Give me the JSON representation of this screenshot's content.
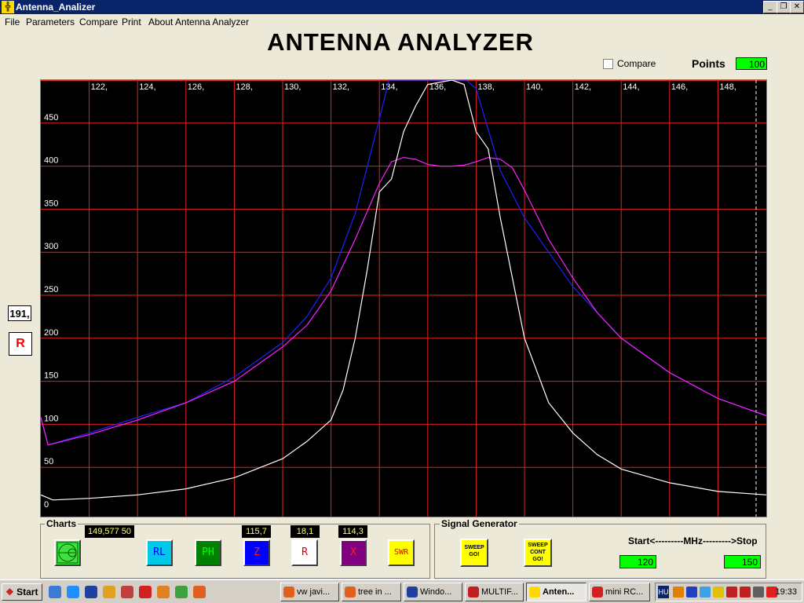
{
  "window": {
    "title": "Antenna_Analizer",
    "app_icon": "antenna-icon",
    "min_glyph": "_",
    "max_glyph": "❐",
    "close_glyph": "✕"
  },
  "menu": [
    "File",
    "Parameters",
    "Compare",
    "Print",
    "About Antenna Analyzer"
  ],
  "app_title": "ANTENNA ANALYZER",
  "compare_label": "Compare",
  "compare_checked": false,
  "points": {
    "label": "Points",
    "value": "100"
  },
  "side": {
    "value": "191,",
    "button_label": "R"
  },
  "charts_group": {
    "label": "Charts",
    "freq_readout": "149,577 50",
    "readouts": {
      "z": "115,7",
      "r": "18,1",
      "x": "114,3"
    },
    "buttons": [
      {
        "label": "",
        "icon": "smith-chart-icon",
        "color": "#40e040"
      },
      {
        "label": "RL",
        "color": "#00c8e8",
        "text_color": "#0000ff"
      },
      {
        "label": "PH",
        "color": "#008000",
        "text_color": "#00ff00"
      },
      {
        "label": "Z",
        "color": "#0000ff",
        "text_color": "#ff2020"
      },
      {
        "label": "R",
        "color": "#ffffff",
        "text_color": "#e00000"
      },
      {
        "label": "X",
        "color": "#800080",
        "text_color": "#ff2020"
      },
      {
        "label": "SWR",
        "color": "#ffff00",
        "text_color": "#e00000"
      }
    ]
  },
  "signal_group": {
    "label": "Signal Generator",
    "sweep": [
      "SWEEP",
      "GO!"
    ],
    "sweep_cont": [
      "SWEEP",
      "CONT",
      "GO!"
    ]
  },
  "range": {
    "label": "Start<---------MHz--------->Stop",
    "start": "120",
    "stop": "150"
  },
  "chart_data": {
    "type": "line",
    "x_range": [
      120,
      150
    ],
    "y_range": [
      0,
      500
    ],
    "x_ticks": [
      122,
      124,
      126,
      128,
      130,
      132,
      134,
      136,
      138,
      140,
      142,
      144,
      146,
      148
    ],
    "x_tick_labels": [
      "122,",
      "124,",
      "126,",
      "128,",
      "130,",
      "132,",
      "134,",
      "136,",
      "138,",
      "140,",
      "142,",
      "144,",
      "146,",
      "148,"
    ],
    "y_ticks": [
      0,
      50,
      100,
      150,
      200,
      250,
      300,
      350,
      400,
      450
    ],
    "y_tick_labels": [
      "0",
      "50",
      "100",
      "150",
      "200",
      "250",
      "300",
      "350",
      "400",
      "450"
    ],
    "grid": true,
    "grid_color": "#e02020",
    "cursor_x": 149.577,
    "series": [
      {
        "color": "#2020ff",
        "x": [
          120,
          120.3,
          122,
          124,
          126,
          128,
          130,
          131,
          132,
          133,
          134,
          134.4,
          137.6,
          138,
          139,
          140,
          141,
          142,
          143,
          144,
          146,
          148,
          150
        ],
        "y": [
          108,
          76,
          90,
          108,
          125,
          155,
          195,
          225,
          270,
          345,
          455,
          500,
          500,
          490,
          395,
          340,
          300,
          260,
          230,
          200,
          160,
          130,
          110
        ]
      },
      {
        "color": "#ff20ff",
        "x": [
          120,
          120.3,
          122,
          124,
          126,
          128,
          130,
          131,
          132,
          133,
          134,
          134.5,
          135,
          135.5,
          136,
          136.5,
          137,
          137.5,
          138,
          138.5,
          139,
          139.5,
          140,
          141,
          142,
          143,
          144,
          146,
          148,
          150
        ],
        "y": [
          108,
          76,
          88,
          105,
          125,
          150,
          190,
          215,
          255,
          315,
          380,
          405,
          410,
          408,
          402,
          400,
          400,
          401,
          405,
          410,
          408,
          398,
          372,
          315,
          270,
          230,
          200,
          160,
          130,
          110
        ]
      },
      {
        "color": "#ffffff",
        "x": [
          120,
          120.5,
          122,
          124,
          126,
          128,
          130,
          131,
          132,
          132.5,
          133,
          133.5,
          134,
          134.5,
          135,
          135.5,
          136,
          137,
          137.5,
          138,
          138.5,
          139,
          140,
          141,
          142,
          143,
          144,
          146,
          148,
          150
        ],
        "y": [
          18,
          12,
          14,
          18,
          25,
          38,
          60,
          80,
          105,
          140,
          200,
          280,
          370,
          385,
          440,
          470,
          495,
          500,
          495,
          440,
          420,
          340,
          200,
          125,
          90,
          65,
          48,
          32,
          22,
          18
        ]
      }
    ]
  },
  "taskbar": {
    "start_label": "Start",
    "quick_launch": [
      {
        "icon": "ie-icon",
        "color": "#3a7bd5"
      },
      {
        "icon": "ie-icon",
        "color": "#1e90ff"
      },
      {
        "icon": "floppy-icon",
        "color": "#2040a0"
      },
      {
        "icon": "pencil-icon",
        "color": "#e0a020"
      },
      {
        "icon": "palette-icon",
        "color": "#c04040"
      },
      {
        "icon": "lifebuoy-icon",
        "color": "#d02020"
      },
      {
        "icon": "media-icon",
        "color": "#e08020"
      },
      {
        "icon": "image-icon",
        "color": "#40a040"
      },
      {
        "icon": "firefox-icon",
        "color": "#e06020"
      }
    ],
    "tasks": [
      {
        "label": "vw javi...",
        "icon": "firefox-icon",
        "color": "#e06020",
        "active": false
      },
      {
        "label": "tree in ...",
        "icon": "firefox-icon",
        "color": "#e06020",
        "active": false
      },
      {
        "label": "Windo...",
        "icon": "floppy-icon",
        "color": "#2040a0",
        "active": false
      },
      {
        "label": "MULTIF...",
        "icon": "app-icon",
        "color": "#c02020",
        "active": false
      },
      {
        "label": "Anten...",
        "icon": "antenna-icon",
        "color": "#ffd800",
        "active": true
      },
      {
        "label": "mini RC...",
        "icon": "lifebuoy-icon",
        "color": "#d02020",
        "active": false
      }
    ],
    "tray": {
      "lang": "HU",
      "clock": "19:33",
      "icons": [
        "#e08000",
        "#2040c0",
        "#40a0e0",
        "#e0c000",
        "#c02020",
        "#c02020",
        "#606060",
        "#e02020"
      ]
    }
  }
}
